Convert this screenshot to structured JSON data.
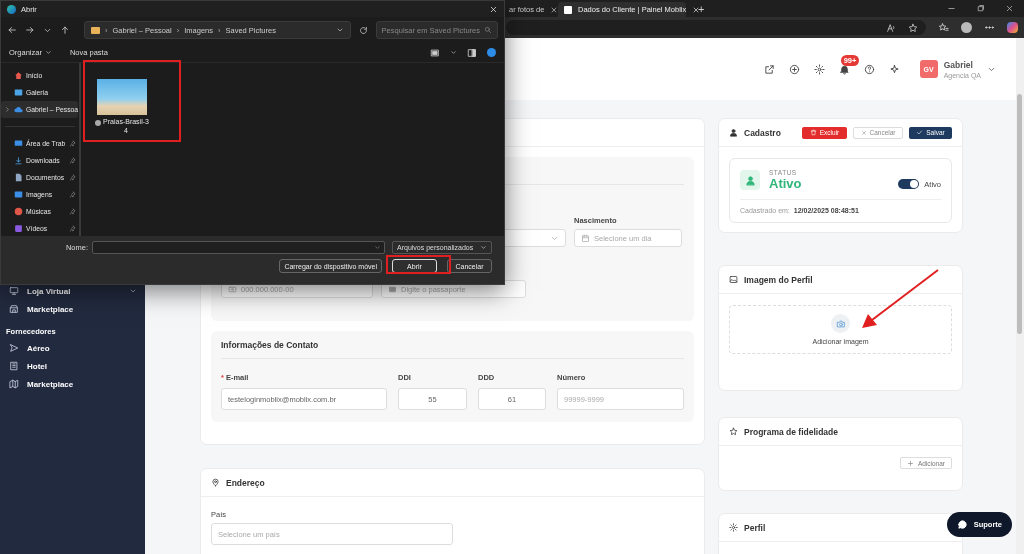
{
  "browser": {
    "tabs": [
      {
        "title": "ar fotos de",
        "selected": false
      },
      {
        "title": "Dados do Cliente | Painel Moblix",
        "selected": true
      }
    ],
    "new_tab": "+"
  },
  "header": {
    "notification_badge": "99+",
    "user": {
      "initials": "GV",
      "name": "Gabriel",
      "agency": "Agencia QA"
    }
  },
  "sidebar": {
    "sections": [
      {
        "items": [
          {
            "label": "Loja Virtual",
            "expandable": true
          },
          {
            "label": "Marketplace",
            "expandable": false
          }
        ]
      },
      {
        "title": "Fornecedores",
        "items": [
          {
            "label": "Aéreo",
            "expandable": false
          },
          {
            "label": "Hotel",
            "expandable": false
          },
          {
            "label": "Marketplace",
            "expandable": false
          }
        ]
      }
    ]
  },
  "file_dialog": {
    "title": "Abrir",
    "breadcrumb": [
      "Gabriel – Pessoal",
      "Imagens",
      "Saved Pictures"
    ],
    "breadcrumb_separator": "›",
    "search_placeholder": "Pesquisar em Saved Pictures",
    "toolbar": {
      "organize": "Organizar",
      "new_folder": "Nova pasta"
    },
    "nav": [
      {
        "items": [
          {
            "label": "Início",
            "selected": false,
            "expandable": false,
            "pinned": false
          },
          {
            "label": "Galeria",
            "selected": false,
            "expandable": false,
            "pinned": false
          },
          {
            "label": "Gabriel – Pessoa",
            "selected": true,
            "expandable": true,
            "pinned": false
          }
        ]
      },
      {
        "items": [
          {
            "label": "Área de Trab",
            "selected": false,
            "expandable": false,
            "pinned": true
          },
          {
            "label": "Downloads",
            "selected": false,
            "expandable": false,
            "pinned": true
          },
          {
            "label": "Documentos",
            "selected": false,
            "expandable": false,
            "pinned": true
          },
          {
            "label": "Imagens",
            "selected": false,
            "expandable": false,
            "pinned": true
          },
          {
            "label": "Músicas",
            "selected": false,
            "expandable": false,
            "pinned": true
          },
          {
            "label": "Vídeos",
            "selected": false,
            "expandable": false,
            "pinned": true
          }
        ]
      }
    ],
    "files": [
      {
        "name": "Praias-Brasil-34"
      }
    ],
    "filename_label": "Nome:",
    "file_type": "Arquivos personalizados",
    "buttons": {
      "mobile": "Carregar do dispositivo móvel",
      "open": "Abrir",
      "cancel": "Cancelar"
    }
  },
  "client_form": {
    "birth": {
      "label": "Nascimento",
      "placeholder": "Selecione um dia"
    },
    "cpf_placeholder": "000.000.000-00",
    "passport_placeholder": "Digite o passaporte",
    "contact": {
      "title": "Informações de Contato",
      "email": {
        "label": "E-mail",
        "required_mark": "*",
        "value": "testeloginmoblix@moblix.com.br"
      },
      "ddi": {
        "label": "DDI",
        "value": "55"
      },
      "ddd": {
        "label": "DDD",
        "value": "61"
      },
      "number": {
        "label": "Número",
        "placeholder": "99999-9999"
      }
    }
  },
  "address": {
    "title": "Endereço",
    "country": {
      "label": "País",
      "placeholder": "Selecione um país"
    }
  },
  "registration": {
    "title": "Cadastro",
    "buttons": {
      "delete": "Excluir",
      "cancel": "Cancelar",
      "save": "Salvar"
    },
    "status_label": "STATUS",
    "status": "Ativo",
    "active": {
      "on": true,
      "label": "Ativo"
    },
    "created_label": "Cadastrado em:",
    "created": "12/02/2025 08:48:51"
  },
  "profile_image": {
    "title": "Imagem do Perfil",
    "add_label": "Adicionar imagem"
  },
  "loyalty": {
    "title": "Programa de fidelidade",
    "add_button": "Adicionar"
  },
  "profile": {
    "title": "Perfil"
  },
  "support_button": "Suporte"
}
